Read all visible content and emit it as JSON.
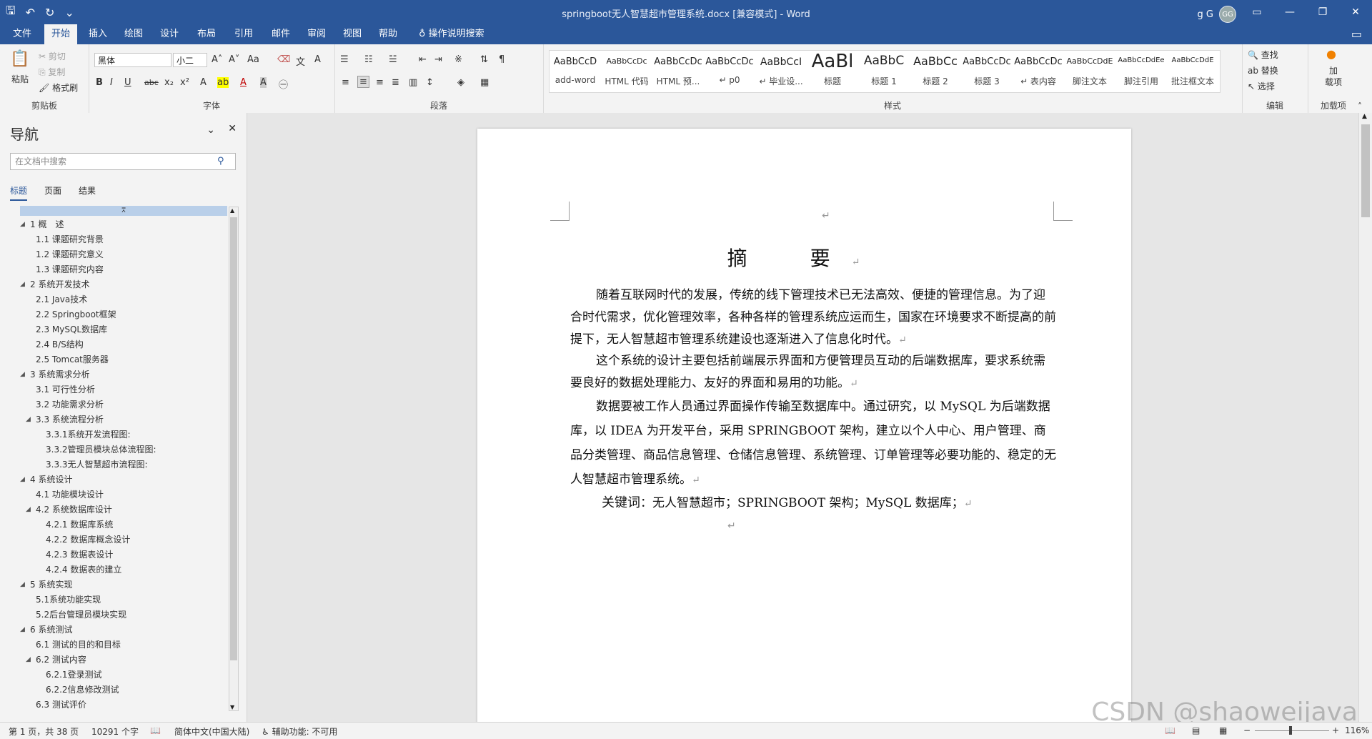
{
  "window": {
    "title": "springboot无人智慧超市管理系统.docx [兼容模式] - Word",
    "user_name": "g G",
    "avatar_initials": "GG",
    "accent": "#2b579a"
  },
  "tabs": [
    "文件",
    "开始",
    "插入",
    "绘图",
    "设计",
    "布局",
    "引用",
    "邮件",
    "审阅",
    "视图",
    "帮助"
  ],
  "tell_me": "操作说明搜索",
  "ribbon": {
    "clipboard": {
      "paste": "粘贴",
      "cut": "剪切",
      "copy": "复制",
      "format_painter": "格式刷",
      "label": "剪贴板"
    },
    "font": {
      "name": "黑体",
      "size": "小二",
      "label": "字体",
      "aa": "Aa",
      "bold": "B",
      "italic": "I",
      "underline": "U",
      "strike": "abc",
      "sub": "x₂",
      "sup": "x²"
    },
    "paragraph": {
      "label": "段落"
    },
    "styles": {
      "label": "样式",
      "items": [
        {
          "sample": "AaBbCcD",
          "name": "add-word"
        },
        {
          "sample": "AaBbCcDc",
          "name": "HTML 代码"
        },
        {
          "sample": "AaBbCcDc",
          "name": "HTML 预..."
        },
        {
          "sample": "AaBbCcDc",
          "name": "↵ p0"
        },
        {
          "sample": "AaBbCcI",
          "name": "↵ 毕业设..."
        },
        {
          "sample": "AaBl",
          "name": "标题"
        },
        {
          "sample": "AaBbC",
          "name": "标题 1"
        },
        {
          "sample": "AaBbCc",
          "name": "标题 2"
        },
        {
          "sample": "AaBbCcDc",
          "name": "标题 3"
        },
        {
          "sample": "AaBbCcDc",
          "name": "↵ 表内容"
        },
        {
          "sample": "AaBbCcDdE",
          "name": "脚注文本"
        },
        {
          "sample": "AaBbCcDdEe",
          "name": "脚注引用"
        },
        {
          "sample": "AaBbCcDdE",
          "name": "批注框文本"
        }
      ]
    },
    "editing": {
      "find": "查找",
      "replace": "替换",
      "select": "选择",
      "label": "编辑"
    },
    "addins": {
      "line1": "加",
      "line2": "载项",
      "label": "加载项"
    }
  },
  "nav": {
    "title": "导航",
    "search_placeholder": "在文档中搜索",
    "tabs": [
      "标题",
      "页面",
      "结果"
    ],
    "items": [
      {
        "text": "1 概　述",
        "level": 1,
        "expanded": true
      },
      {
        "text": "1.1 课题研究背景",
        "level": 2
      },
      {
        "text": "1.2 课题研究意义",
        "level": 2
      },
      {
        "text": "1.3 课题研究内容",
        "level": 2
      },
      {
        "text": "2 系统开发技术",
        "level": 1,
        "expanded": true
      },
      {
        "text": "2.1 Java技术",
        "level": 2
      },
      {
        "text": "2.2 Springboot框架",
        "level": 2
      },
      {
        "text": "2.3 MySQL数据库",
        "level": 2
      },
      {
        "text": "2.4 B/S结构",
        "level": 2
      },
      {
        "text": "2.5 Tomcat服务器",
        "level": 2
      },
      {
        "text": "3 系统需求分析",
        "level": 1,
        "expanded": true
      },
      {
        "text": "3.1 可行性分析",
        "level": 2
      },
      {
        "text": "3.2 功能需求分析",
        "level": 2
      },
      {
        "text": "3.3 系统流程分析",
        "level": 2,
        "expanded": true
      },
      {
        "text": "3.3.1系统开发流程图:",
        "level": 3
      },
      {
        "text": "3.3.2管理员模块总体流程图:",
        "level": 3
      },
      {
        "text": "3.3.3无人智慧超市流程图:",
        "level": 3
      },
      {
        "text": "4 系统设计",
        "level": 1,
        "expanded": true
      },
      {
        "text": "4.1 功能模块设计",
        "level": 2
      },
      {
        "text": "4.2 系统数据库设计",
        "level": 2,
        "expanded": true
      },
      {
        "text": "4.2.1 数据库系统",
        "level": 3
      },
      {
        "text": "4.2.2 数据库概念设计",
        "level": 3
      },
      {
        "text": "4.2.3 数据表设计",
        "level": 3
      },
      {
        "text": "4.2.4 数据表的建立",
        "level": 3
      },
      {
        "text": "5 系统实现",
        "level": 1,
        "expanded": true
      },
      {
        "text": "5.1系统功能实现",
        "level": 2
      },
      {
        "text": "5.2后台管理员模块实现",
        "level": 2
      },
      {
        "text": "6 系统测试",
        "level": 1,
        "expanded": true
      },
      {
        "text": "6.1 测试的目的和目标",
        "level": 2
      },
      {
        "text": "6.2 测试内容",
        "level": 2,
        "expanded": true
      },
      {
        "text": "6.2.1登录测试",
        "level": 3
      },
      {
        "text": "6.2.2信息修改测试",
        "level": 3
      },
      {
        "text": "6.3 测试评价",
        "level": 2
      }
    ]
  },
  "document": {
    "heading": "摘　要",
    "paragraphs": [
      "随着互联网时代的发展，传统的线下管理技术已无法高效、便捷的管理信息。为了迎合时代需求，优化管理效率，各种各样的管理系统应运而生，国家在环境要求不断提高的前提下，无人智慧超市管理系统建设也逐渐进入了信息化时代。",
      "这个系统的设计主要包括前端展示界面和方便管理员互动的后端数据库，要求系统需要良好的数据处理能力、友好的界面和易用的功能。",
      "数据要被工作人员通过界面操作传输至数据库中。通过研究，以 MySQL 为后端数据库，以 IDEA 为开发平台，采用 SPRINGBOOT 架构，建立以个人中心、用户管理、商品分类管理、商品信息管理、仓储信息管理、系统管理、订单管理等必要功能的、稳定的无人智慧超市管理系统。"
    ],
    "keywords_label": "关键词",
    "keywords": "：无人智慧超市；SPRINGBOOT 架构；MySQL 数据库；"
  },
  "status": {
    "page": "第 1 页，共 38 页",
    "words": "10291 个字",
    "language": "简体中文(中国大陆)",
    "accessibility": "辅助功能: 不可用",
    "zoom": "116%"
  },
  "watermark": "CSDN @shaoweijava"
}
